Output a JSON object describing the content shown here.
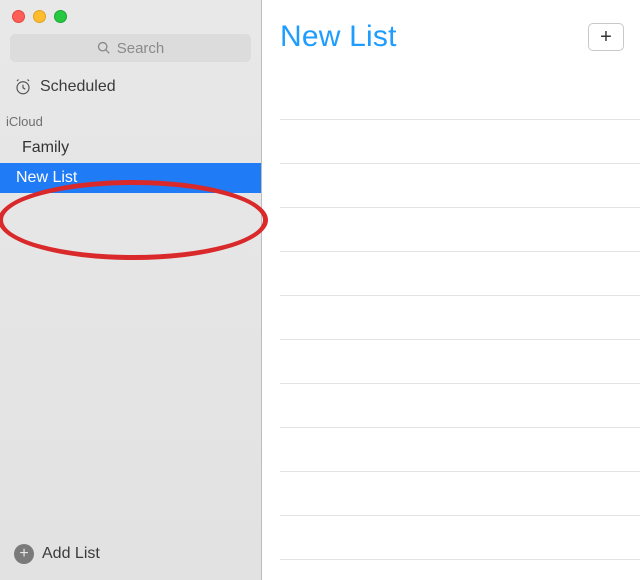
{
  "search": {
    "placeholder": "Search"
  },
  "sidebar": {
    "scheduled_label": "Scheduled",
    "section_label": "iCloud",
    "lists": [
      {
        "label": "Family",
        "selected": false
      },
      {
        "label": "New List",
        "selected": true
      }
    ],
    "add_list_label": "Add List"
  },
  "main": {
    "title": "New List"
  },
  "colors": {
    "accent": "#1e9dff",
    "selection": "#1f7bf6",
    "annotation": "#d9292a"
  }
}
